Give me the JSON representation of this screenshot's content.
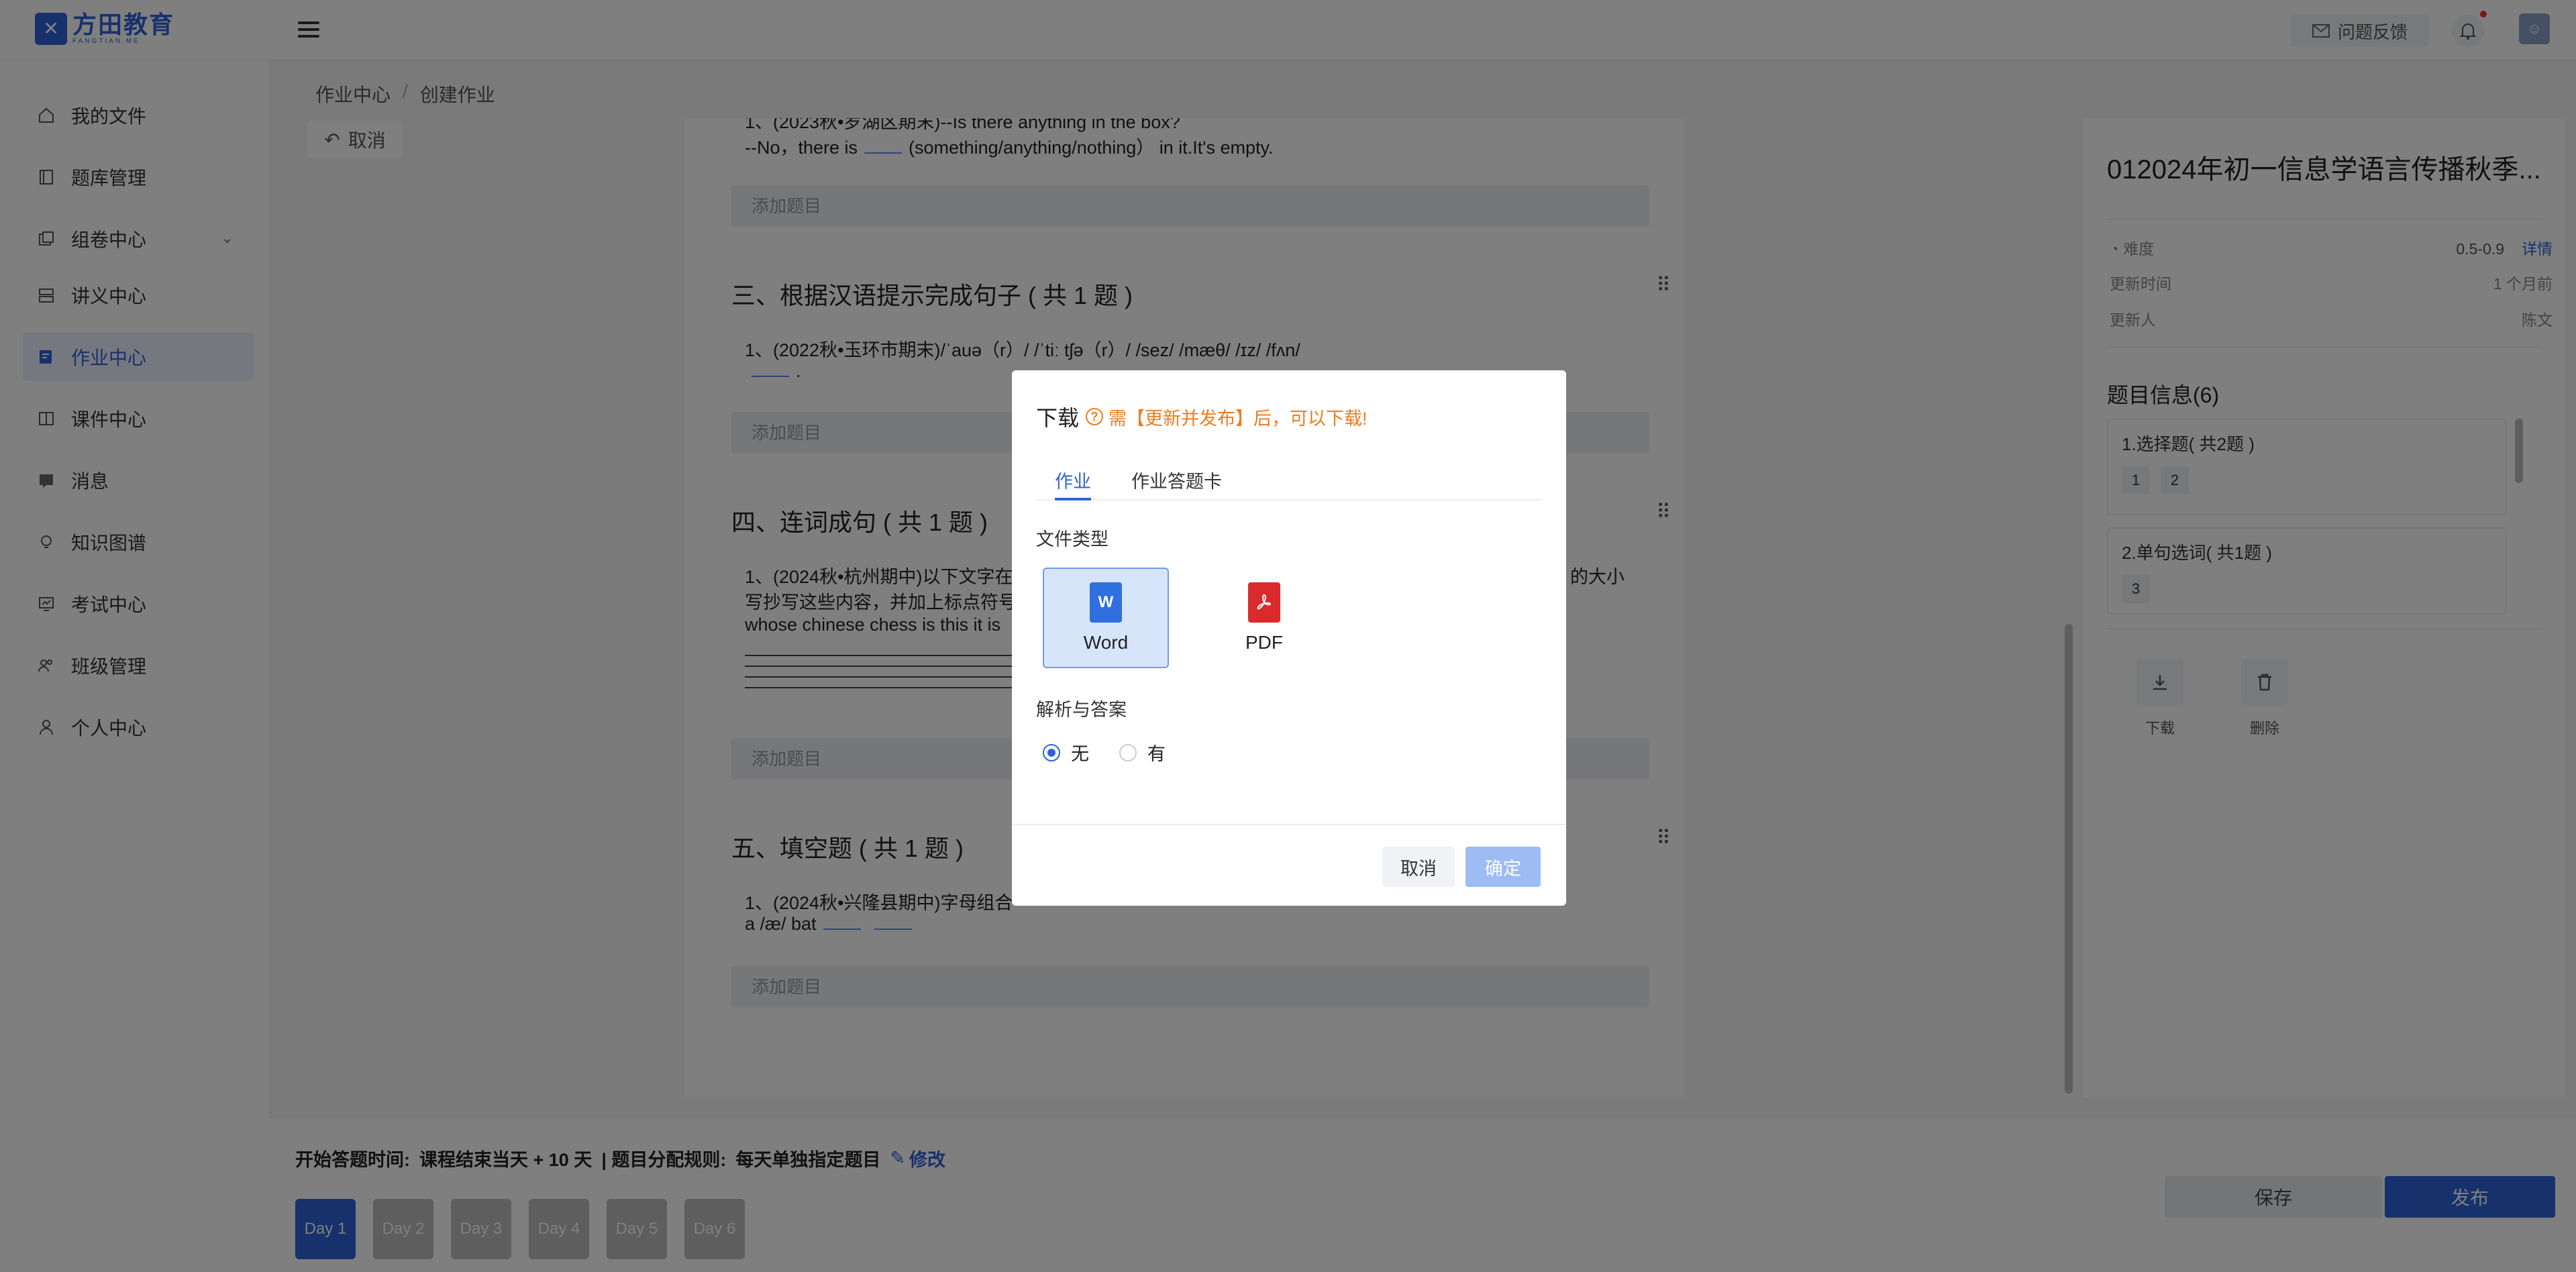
{
  "app": {
    "logo_text": "方田教育",
    "logo_sub": "FANGTIAN.ME",
    "feedback_label": "问题反馈"
  },
  "sidebar": {
    "items": [
      {
        "label": "我的文件",
        "icon": "home-icon"
      },
      {
        "label": "题库管理",
        "icon": "book-icon"
      },
      {
        "label": "组卷中心",
        "icon": "folder-icon"
      },
      {
        "label": "讲义中心",
        "icon": "handout-icon"
      },
      {
        "label": "作业中心",
        "icon": "homework-icon"
      },
      {
        "label": "课件中心",
        "icon": "courseware-icon"
      },
      {
        "label": "消息",
        "icon": "message-icon"
      },
      {
        "label": "知识图谱",
        "icon": "bulb-icon"
      },
      {
        "label": "考试中心",
        "icon": "exam-icon"
      },
      {
        "label": "班级管理",
        "icon": "class-icon"
      },
      {
        "label": "个人中心",
        "icon": "user-icon"
      }
    ]
  },
  "breadcrumb": {
    "parent": "作业中心",
    "separator": "/",
    "current": "创建作业"
  },
  "cancel_top": "取消",
  "editor": {
    "q1_line1": "1、(2023秋•罗湖区期末)--Is there anything in the box?",
    "q1_line2_a": "--No，there is",
    "q1_line2_b": "(something/anything/nothing） in it.It's empty.",
    "add_question": "添加题目",
    "section3_title": "三、根据汉语提示完成句子 ( 共 1 题 )",
    "q3_line1": "1、(2022秋•玉环市期末)/ˈauə（r）/ /ˈtiː tʃə（r）/ /sez/ /mæθ/ /ɪz/ /fʌn/",
    "q3_line2": ".",
    "section4_title": "四、连词成句 ( 共 1 题 )",
    "q4_line1": "1、(2024秋•杭州期中)以下文字在",
    "q4_line1_tail": "的大小",
    "q4_line2": "写抄写这些内容，并加上标点符号",
    "q4_line3": "whose chinese chess is this it is",
    "section5_title": "五、填空题 ( 共 1 题 )",
    "q5_line1": "1、(2024秋•兴隆县期中)字母组合",
    "q5_line2": "a /æ/ bat"
  },
  "right_panel": {
    "title": "012024年初一信息学语言传播秋季...",
    "difficulty_label": "难度",
    "difficulty_value": "0.5-0.9",
    "detail_link": "详情",
    "updated_time_label": "更新时间",
    "updated_time_value": "1 个月前",
    "updater_label": "更新人",
    "updater_value": "陈文",
    "questions_header": "题目信息(6)",
    "groups": [
      {
        "title": "1.选择题( 共2题 )",
        "nums": [
          "1",
          "2"
        ]
      },
      {
        "title": "2.单句选词( 共1题 )",
        "nums": [
          "3"
        ]
      }
    ],
    "download_label": "下载",
    "delete_label": "删除"
  },
  "bottom": {
    "start_label": "开始答题时间:",
    "start_value": "课程结束当天 + 10 天",
    "rule_label": "| 题目分配规则:",
    "rule_value": "每天单独指定题目",
    "edit_label": "修改",
    "days": [
      "Day 1",
      "Day 2",
      "Day 3",
      "Day 4",
      "Day 5",
      "Day 6"
    ],
    "save_label": "保存",
    "publish_label": "发布"
  },
  "modal": {
    "title": "下载",
    "warning": "需【更新并发布】后，可以下载!",
    "tabs": [
      "作业",
      "作业答题卡"
    ],
    "file_type_label": "文件类型",
    "file_types": [
      {
        "label": "Word",
        "selected": true,
        "color": "#2f6fe0"
      },
      {
        "label": "PDF",
        "selected": false,
        "color": "#d92b2b"
      }
    ],
    "answer_label": "解析与答案",
    "answer_options": [
      {
        "label": "无",
        "selected": true
      },
      {
        "label": "有",
        "selected": false
      }
    ],
    "cancel_label": "取消",
    "ok_label": "确定"
  }
}
